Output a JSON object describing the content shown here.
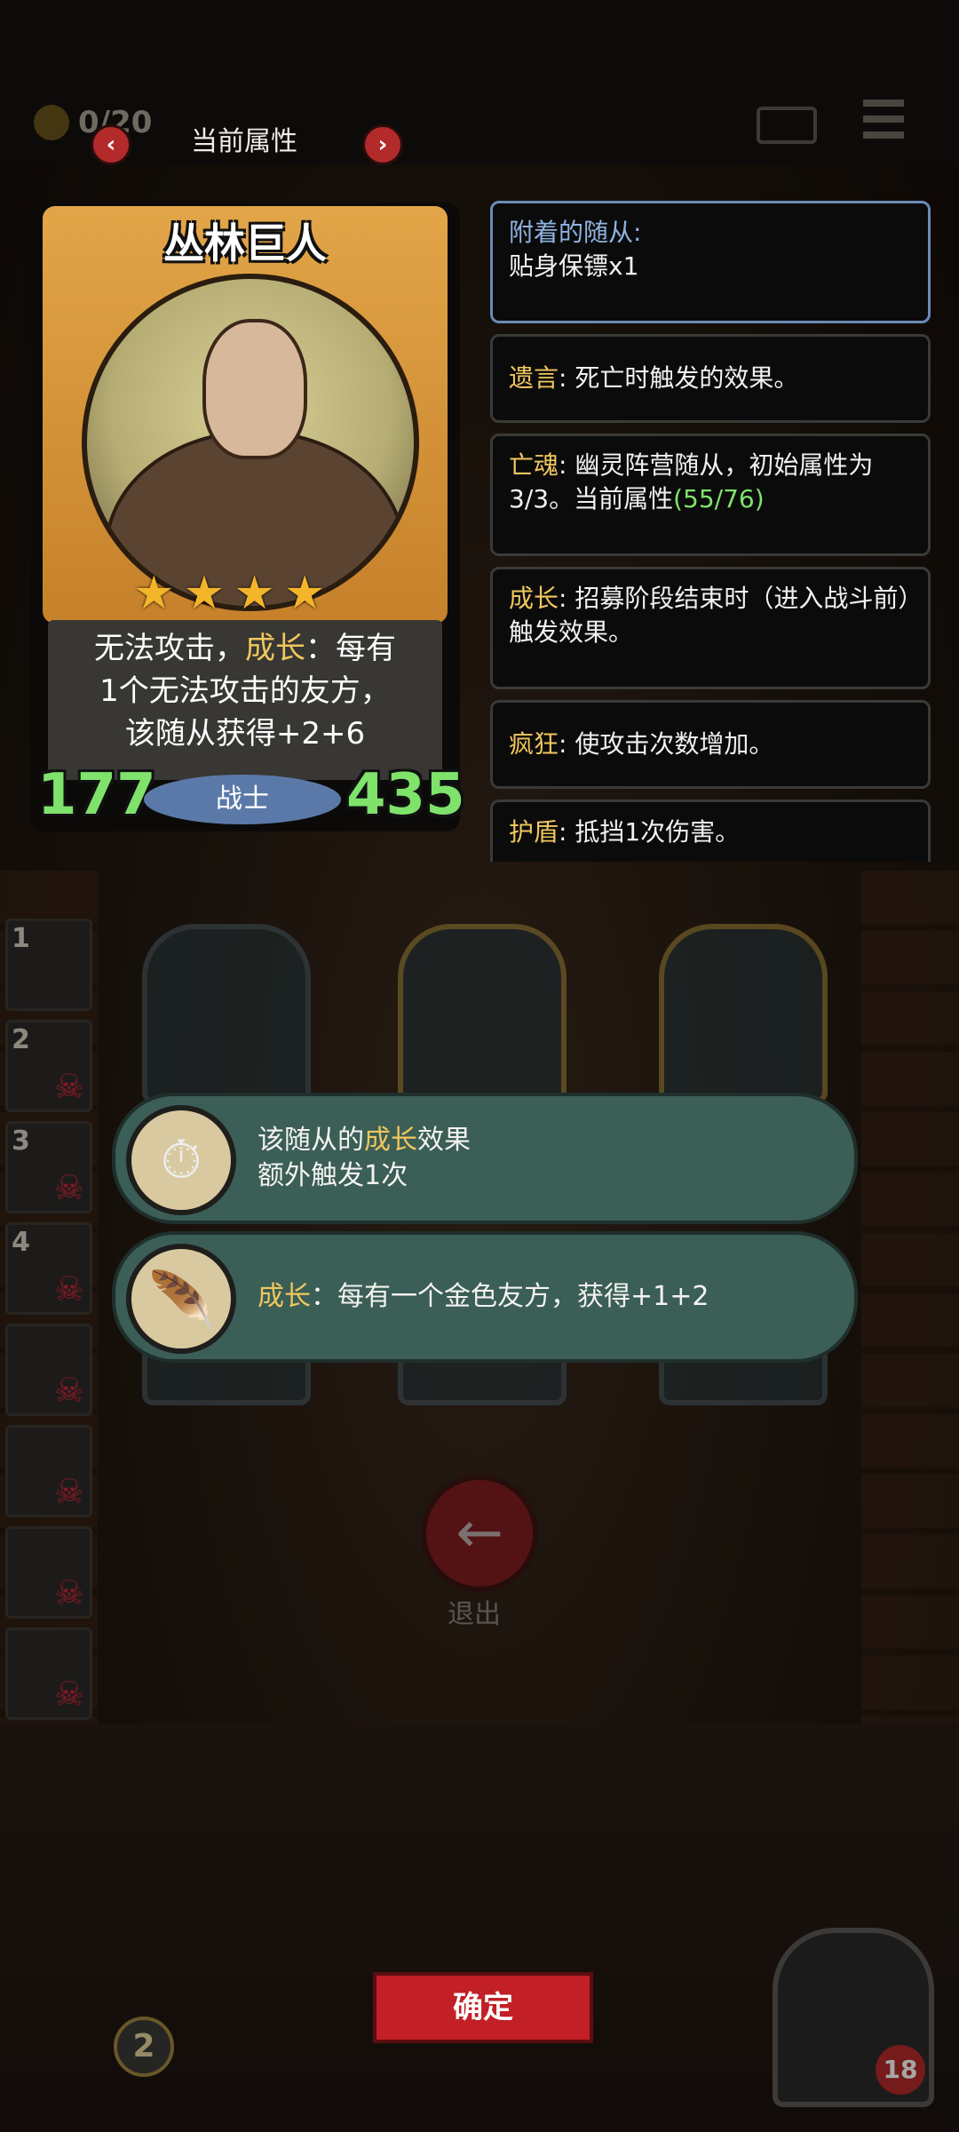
{
  "topbar": {
    "coins": "0/20",
    "nav_title": "当前属性",
    "prev_arrow": "‹",
    "next_arrow": "›"
  },
  "card": {
    "name": "丛林巨人",
    "stars": 4,
    "desc_1": "无法攻击，",
    "desc_kw": "成长",
    "desc_2": "：每有",
    "desc_3": "1个无法攻击的友方，",
    "desc_4": "该随从获得+2+6",
    "attack": "177",
    "health": "435",
    "type": "战士"
  },
  "keywords": {
    "attached_title": "附着的随从:",
    "attached_value": "贴身保镖x1",
    "deathrattle_name": "遗言",
    "deathrattle_desc": ": 死亡时触发的效果。",
    "ghost_name": "亡魂",
    "ghost_desc": ": 幽灵阵营随从，初始属性为3/3。当前属性",
    "ghost_stats": "(55/76)",
    "growth_name": "成长",
    "growth_desc": ": 招募阶段结束时（进入战斗前）触发效果。",
    "frenzy_name": "疯狂",
    "frenzy_desc": ": 使攻击次数增加。",
    "shield_name": "护盾",
    "shield_desc": ": 抵挡1次伤害。"
  },
  "lineup": [
    "1",
    "2",
    "3",
    "4"
  ],
  "bonuses": [
    {
      "icon": "stopwatch-icon",
      "line1_pre": "该随从的",
      "line1_kw": "成长",
      "line1_post": "效果",
      "line2": "额外触发1次"
    },
    {
      "icon": "golden-feather-icon",
      "kw": "成长",
      "text": "：每有一个金色友方，获得+1+2"
    }
  ],
  "exit_label": "退出",
  "confirm_label": "确定",
  "level": "2",
  "hero_hp": "18",
  "colors": {
    "accent_red": "#c21f26",
    "keyword_gold": "#f0c75e",
    "stat_green": "#7fe36b",
    "banner_green": "#3b5e56"
  }
}
